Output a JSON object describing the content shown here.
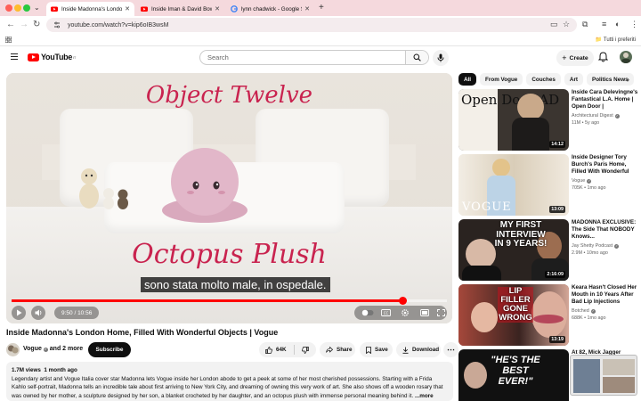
{
  "browser": {
    "tabs": [
      {
        "title": "Inside Madonna's London Ho",
        "active": true
      },
      {
        "title": "Inside Iman & David Bowie's",
        "active": false
      },
      {
        "title": "lynn chadwick - Google Searc",
        "active": false
      }
    ],
    "url": "youtube.com/watch?v=kip6oIB3wsM",
    "bookmarks_right": "Tutti i preferiti"
  },
  "youtube": {
    "logo": "YouTube",
    "logo_sup": "IT",
    "search_placeholder": "Search",
    "create_label": "Create",
    "colors": {
      "brand": "#ff0000",
      "overlay_text": "#c9234f"
    }
  },
  "video": {
    "overlay_title": "Object Twelve",
    "overlay_caption": "Octopus Plush",
    "subtitle": "sono stata molto male, in ospedale.",
    "time": "9:50 / 10:56",
    "progress": 0.8994,
    "title": "Inside Madonna's London Home, Filled With Wonderful Objects | Vogue",
    "channel": "Vogue",
    "channel_suffix": "and 2 more",
    "subscribe_label": "Subscribe",
    "likes": "64K",
    "share_label": "Share",
    "save_label": "Save",
    "download_label": "Download",
    "views": "1.7M views",
    "age": "1 month ago",
    "description": "Legendary artist and Vogue Italia cover star Madonna lets Vogue inside her London abode to get a peek at some of her most cherished possessions. Starting with a Frida Kahlo self-portrait, Madonna tells an incredible tale about first arriving to New York City, and dreaming of owning this very work of art. She also shows off a wooden rosary that was owned by her mother, a sculpture designed by her son, a blanket crocheted by her daughter, and an octopus plush with immense personal meaning behind it.",
    "more_label": "...more"
  },
  "sidebar": {
    "chips": [
      "All",
      "From Vogue",
      "Couches",
      "Art",
      "Politics News"
    ],
    "recommendations": [
      {
        "title": "Inside Cara Delevingne's Fantastical L.A. Home | Open Door | Architectura...",
        "channel": "Architectural Digest",
        "verified": true,
        "views": "11M",
        "age": "5y ago",
        "duration": "14:12",
        "thumb_text": "Open Door AD"
      },
      {
        "title": "Inside Designer Tory Burch's Paris Home, Filled With Wonderful Objects | ...",
        "channel": "Vogue",
        "verified": true,
        "views": "705K",
        "age": "1mo ago",
        "duration": "13:09",
        "thumb_text": "VOGUE"
      },
      {
        "title": "MADONNA EXCLUSIVE: The Side That NOBODY Knows...",
        "channel": "Jay Shetty Podcast",
        "verified": true,
        "views": "2.9M",
        "age": "10mo ago",
        "duration": "2:16:09",
        "thumb_text": "MY FIRST INTERVIEW IN 9 YEARS!"
      },
      {
        "title": "Keara Hasn't Closed Her Mouth in 10 Years After Bad Lip Injections (Befor...",
        "channel": "Botched",
        "verified": true,
        "views": "688K",
        "age": "1mo ago",
        "duration": "13:19",
        "thumb_text": "LIP FILLER GONE WRONG"
      },
      {
        "title": "At 82, Mick Jagger",
        "channel": "",
        "verified": false,
        "views": "",
        "age": "",
        "duration": "",
        "thumb_text": "\"HE'S THE BEST EVER!\""
      }
    ]
  }
}
